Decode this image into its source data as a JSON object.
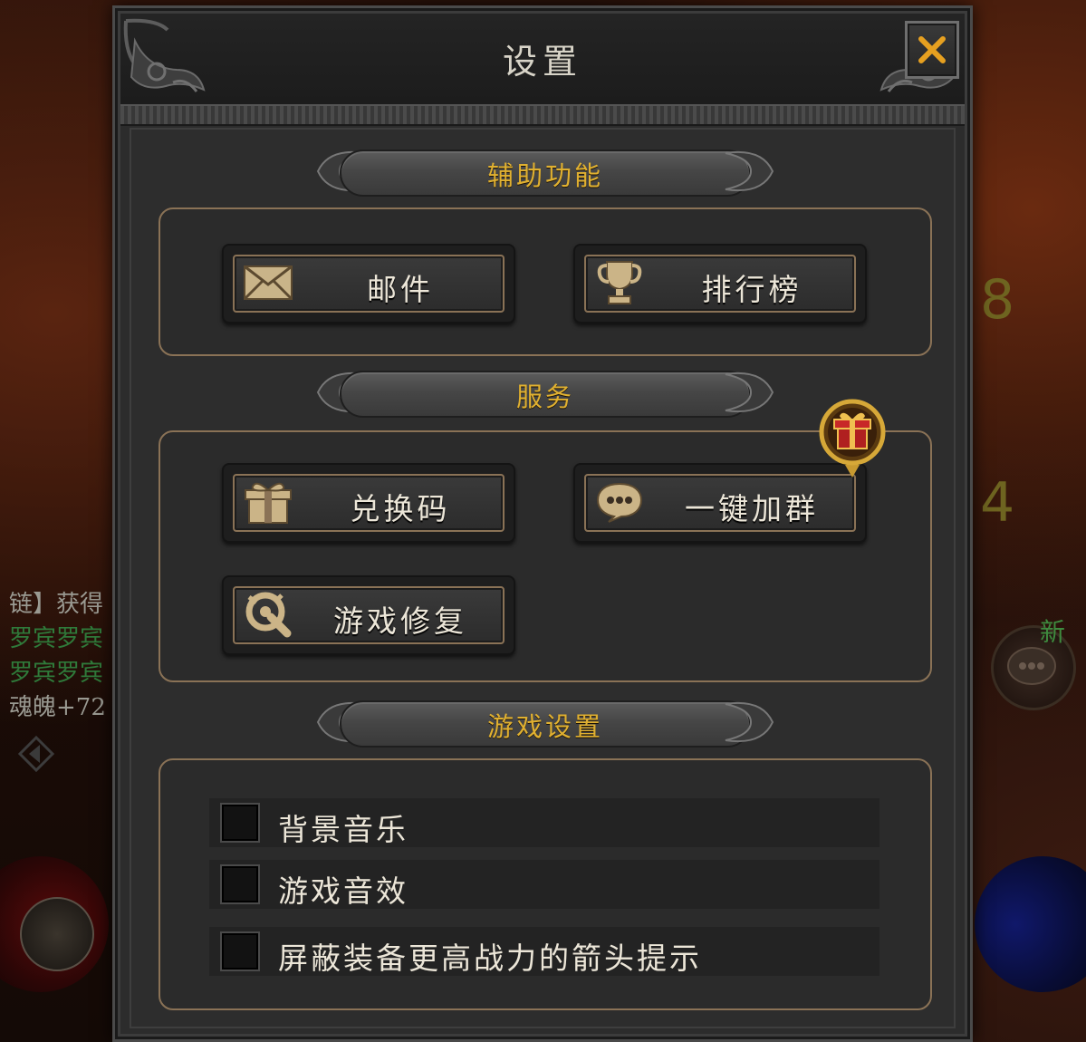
{
  "dialog": {
    "title": "设置",
    "close_label": "×"
  },
  "sections": {
    "assist": {
      "title": "辅助功能"
    },
    "service": {
      "title": "服务"
    },
    "game_settings": {
      "title": "游戏设置"
    }
  },
  "buttons": {
    "mail": {
      "label": "邮件",
      "icon": "mail-icon"
    },
    "ranking": {
      "label": "排行榜",
      "icon": "trophy-icon"
    },
    "redeem": {
      "label": "兑换码",
      "icon": "gift-icon"
    },
    "join_group": {
      "label": "一键加群",
      "icon": "chat-bubble-icon"
    },
    "repair": {
      "label": "游戏修复",
      "icon": "repair-icon"
    }
  },
  "settings": [
    {
      "label": "背景音乐",
      "checked": false
    },
    {
      "label": "游戏音效",
      "checked": false
    },
    {
      "label": "屏蔽装备更高战力的箭头提示",
      "checked": false
    }
  ],
  "background": {
    "chat_lines": [
      "链】获得",
      "罗宾罗宾",
      "罗宾罗宾",
      "魂魄+72"
    ],
    "number_1": "8",
    "number_2": "4",
    "new_tag": "新"
  },
  "colors": {
    "accent_gold": "#e0b030",
    "border_bronze": "#8a7256",
    "panel_bg": "#2c2c2c"
  }
}
